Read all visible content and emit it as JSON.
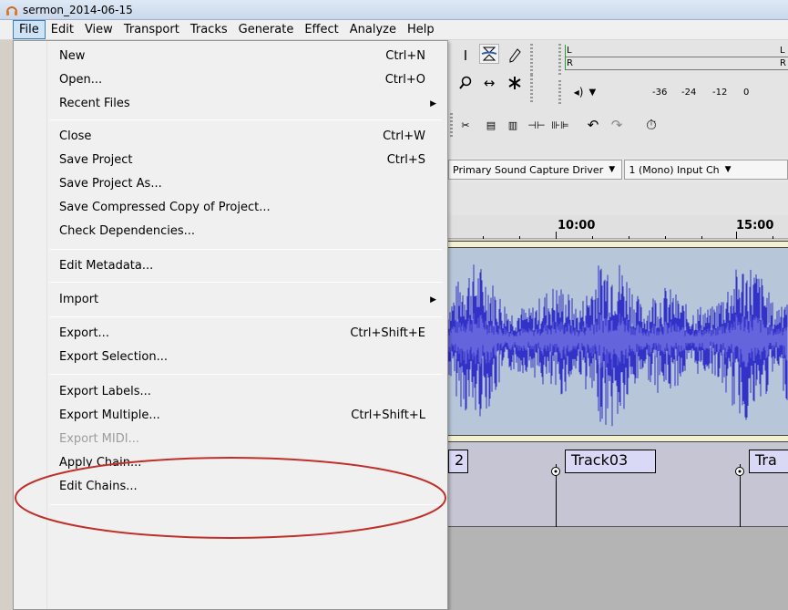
{
  "window": {
    "title": "sermon_2014-06-15"
  },
  "menubar": {
    "items": [
      {
        "label": "File",
        "active": true
      },
      {
        "label": "Edit"
      },
      {
        "label": "View"
      },
      {
        "label": "Transport"
      },
      {
        "label": "Tracks"
      },
      {
        "label": "Generate"
      },
      {
        "label": "Effect"
      },
      {
        "label": "Analyze"
      },
      {
        "label": "Help"
      }
    ]
  },
  "file_menu": {
    "items": [
      {
        "label": "New",
        "shortcut": "Ctrl+N"
      },
      {
        "label": "Open...",
        "shortcut": "Ctrl+O"
      },
      {
        "label": "Recent Files",
        "submenu": true
      },
      {
        "label": "Close",
        "shortcut": "Ctrl+W"
      },
      {
        "label": "Save Project",
        "shortcut": "Ctrl+S"
      },
      {
        "label": "Save Project As..."
      },
      {
        "label": "Save Compressed Copy of Project..."
      },
      {
        "label": "Check Dependencies..."
      },
      {
        "label": "Edit Metadata..."
      },
      {
        "label": "Import",
        "submenu": true
      },
      {
        "label": "Export...",
        "shortcut": "Ctrl+Shift+E"
      },
      {
        "label": "Export Selection..."
      },
      {
        "label": "Export Labels..."
      },
      {
        "label": "Export Multiple...",
        "shortcut": "Ctrl+Shift+L"
      },
      {
        "label": "Export MIDI...",
        "disabled": true
      },
      {
        "label": "Apply Chain..."
      },
      {
        "label": "Edit Chains..."
      }
    ]
  },
  "meters": {
    "left_label": "L",
    "right_label": "R",
    "scale": [
      "-36",
      "-24",
      "-12",
      "0"
    ]
  },
  "device_toolbar": {
    "host_device": "Primary Sound Capture Driver",
    "channels": "1 (Mono) Input Ch"
  },
  "timeline": {
    "labels": [
      "10:00",
      "15:00"
    ]
  },
  "label_track": {
    "labels": [
      "2",
      "Track03",
      "Tra"
    ]
  },
  "colors": {
    "waveform": "#3232c8",
    "waveform_rms": "#6464dc",
    "annotation_circle": "#c0302a",
    "menu_highlight": "#cfe3f7"
  },
  "icons": {
    "app": "audacity-headphones-icon",
    "selection_tool": "i-beam-icon",
    "envelope_tool": "envelope-icon",
    "draw_tool": "pencil-icon",
    "zoom_tool": "magnifier-icon",
    "timeshift_tool": "timeshift-icon",
    "multi_tool": "multi-tool-icon"
  }
}
